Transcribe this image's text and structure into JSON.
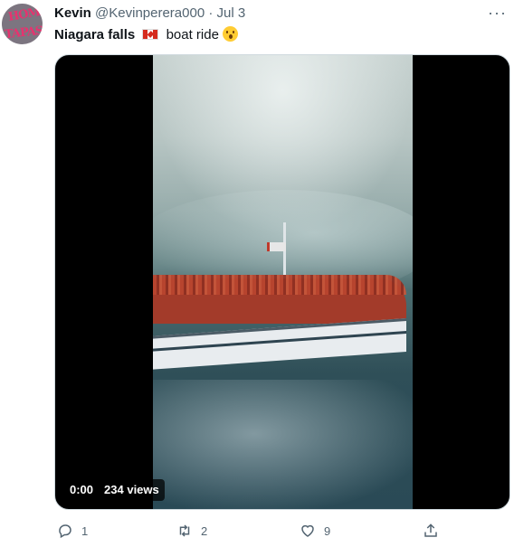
{
  "user": {
    "display_name": "Kevin",
    "handle": "@Kevinperera000",
    "separator": "·",
    "date": "Jul 3",
    "avatar_text": [
      "HOM",
      "TAPAS"
    ]
  },
  "tweet": {
    "text_bold": "Niagara falls",
    "text_rest": "boat ride",
    "flag_icon": "canada-flag-emoji",
    "emoji_icon": "astonished-face-emoji"
  },
  "media": {
    "time": "0:00",
    "views": "234 views"
  },
  "actions": {
    "reply_count": "1",
    "retweet_count": "2",
    "like_count": "9"
  },
  "more_label": "···",
  "colors": {
    "text": "#0f1419",
    "secondary": "#536471",
    "accent_pink": "#e6336f"
  }
}
